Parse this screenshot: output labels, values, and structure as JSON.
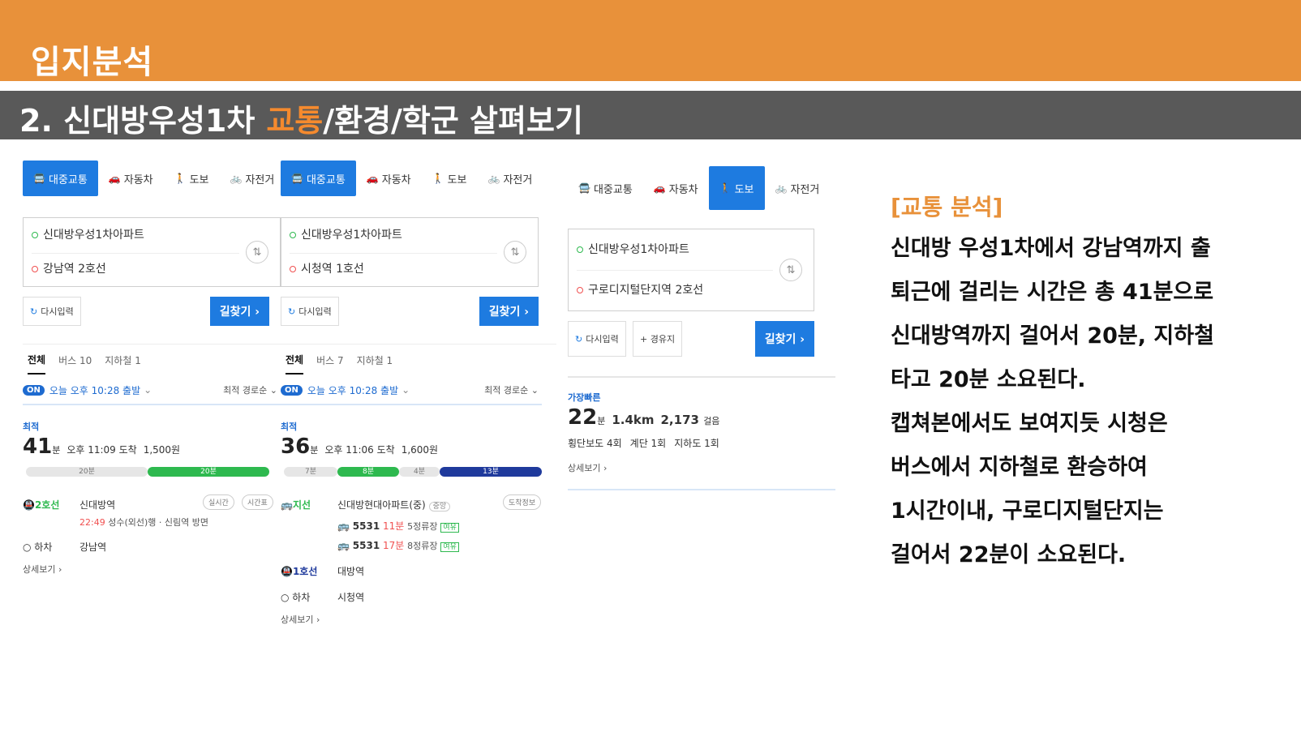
{
  "header": {
    "title": "입지분석"
  },
  "subheader": {
    "prefix": "2. 신대방우성1차",
    "highlight": "교통",
    "suffix": "/환경/학군 살펴보기"
  },
  "panel1": {
    "modes": [
      "대중교통",
      "자동차",
      "도보",
      "자전거"
    ],
    "origin": "신대방우성1차아파트",
    "destination": "강남역 2호선",
    "reset": "다시입력",
    "go": "길찾기 ›",
    "tabs": [
      "전체",
      "버스 10",
      "지하철 1"
    ],
    "on": "ON",
    "departure": "오늘 오후 10:28 출발",
    "sort": "최적 경로순",
    "best": "최적",
    "minutes": "41",
    "unit": "분",
    "arrive": "오후 11:09 도착",
    "fare": "1,500원",
    "seg_walk": "20분",
    "seg_sub": "20분",
    "line": "2호선",
    "station": "신대방역",
    "btn_realtime": "실시간",
    "btn_timetable": "시간표",
    "detail_time": "22:49",
    "detail_dir": "성수(외선)행 · 신림역 방면",
    "alight": "하차",
    "alight_station": "강남역",
    "more": "상세보기 ›"
  },
  "panel2": {
    "modes": [
      "대중교통",
      "자동차",
      "도보",
      "자전거"
    ],
    "origin": "신대방우성1차아파트",
    "destination": "시청역 1호선",
    "reset": "다시입력",
    "go": "길찾기 ›",
    "tabs": [
      "전체",
      "버스 7",
      "지하철 1"
    ],
    "on": "ON",
    "departure": "오늘 오후 10:28 출발",
    "sort": "최적 경로순",
    "best": "최적",
    "minutes": "36",
    "unit": "분",
    "arrive": "오후 11:06 도착",
    "fare": "1,600원",
    "seg1": "7분",
    "seg2": "8분",
    "seg3": "4분",
    "seg4": "13분",
    "line1": "지선",
    "stop1": "신대방현대아파트(중)",
    "stop1_tag": "중앙",
    "arrival_info": "도착정보",
    "bus1": "5531",
    "bus1_time": "11분",
    "bus1_stops": "5정류장",
    "bus1_seat": "여유",
    "bus2": "5531",
    "bus2_time": "17분",
    "bus2_stops": "8정류장",
    "bus2_seat": "여유",
    "line2": "1호선",
    "stop2": "대방역",
    "alight": "하차",
    "alight_station": "시청역",
    "more": "상세보기 ›"
  },
  "panel3": {
    "modes": [
      "대중교통",
      "자동차",
      "도보",
      "자전거"
    ],
    "origin": "신대방우성1차아파트",
    "destination": "구로디지털단지역 2호선",
    "reset": "다시입력",
    "waypoint": "+ 경유지",
    "go": "길찾기 ›",
    "fastest": "가장빠른",
    "minutes": "22",
    "unit": "분",
    "distance": "1.4km",
    "steps": "2,173",
    "steps_unit": "걸음",
    "crossings": "횡단보도 4회",
    "stairs": "계단 1회",
    "underpass": "지하도 1회",
    "more": "상세보기 ›"
  },
  "analysis": {
    "heading": "[교통 분석]",
    "lines": [
      "신대방 우성1차에서 강남역까지 출",
      "퇴근에 걸리는 시간은 총 41분으로",
      "신대방역까지 걸어서 20분, 지하철",
      "타고 20분 소요된다.",
      "캡쳐본에서도 보여지듯 시청은",
      "버스에서 지하철로 환승하여",
      "1시간이내, 구로디지털단지는",
      "걸어서 22분이 소요된다."
    ]
  },
  "colors": {
    "orange": "#E8913A",
    "gray": "#595959",
    "blue": "#1E7BE0",
    "green": "#2EB94F",
    "navy": "#1F3A9C"
  }
}
